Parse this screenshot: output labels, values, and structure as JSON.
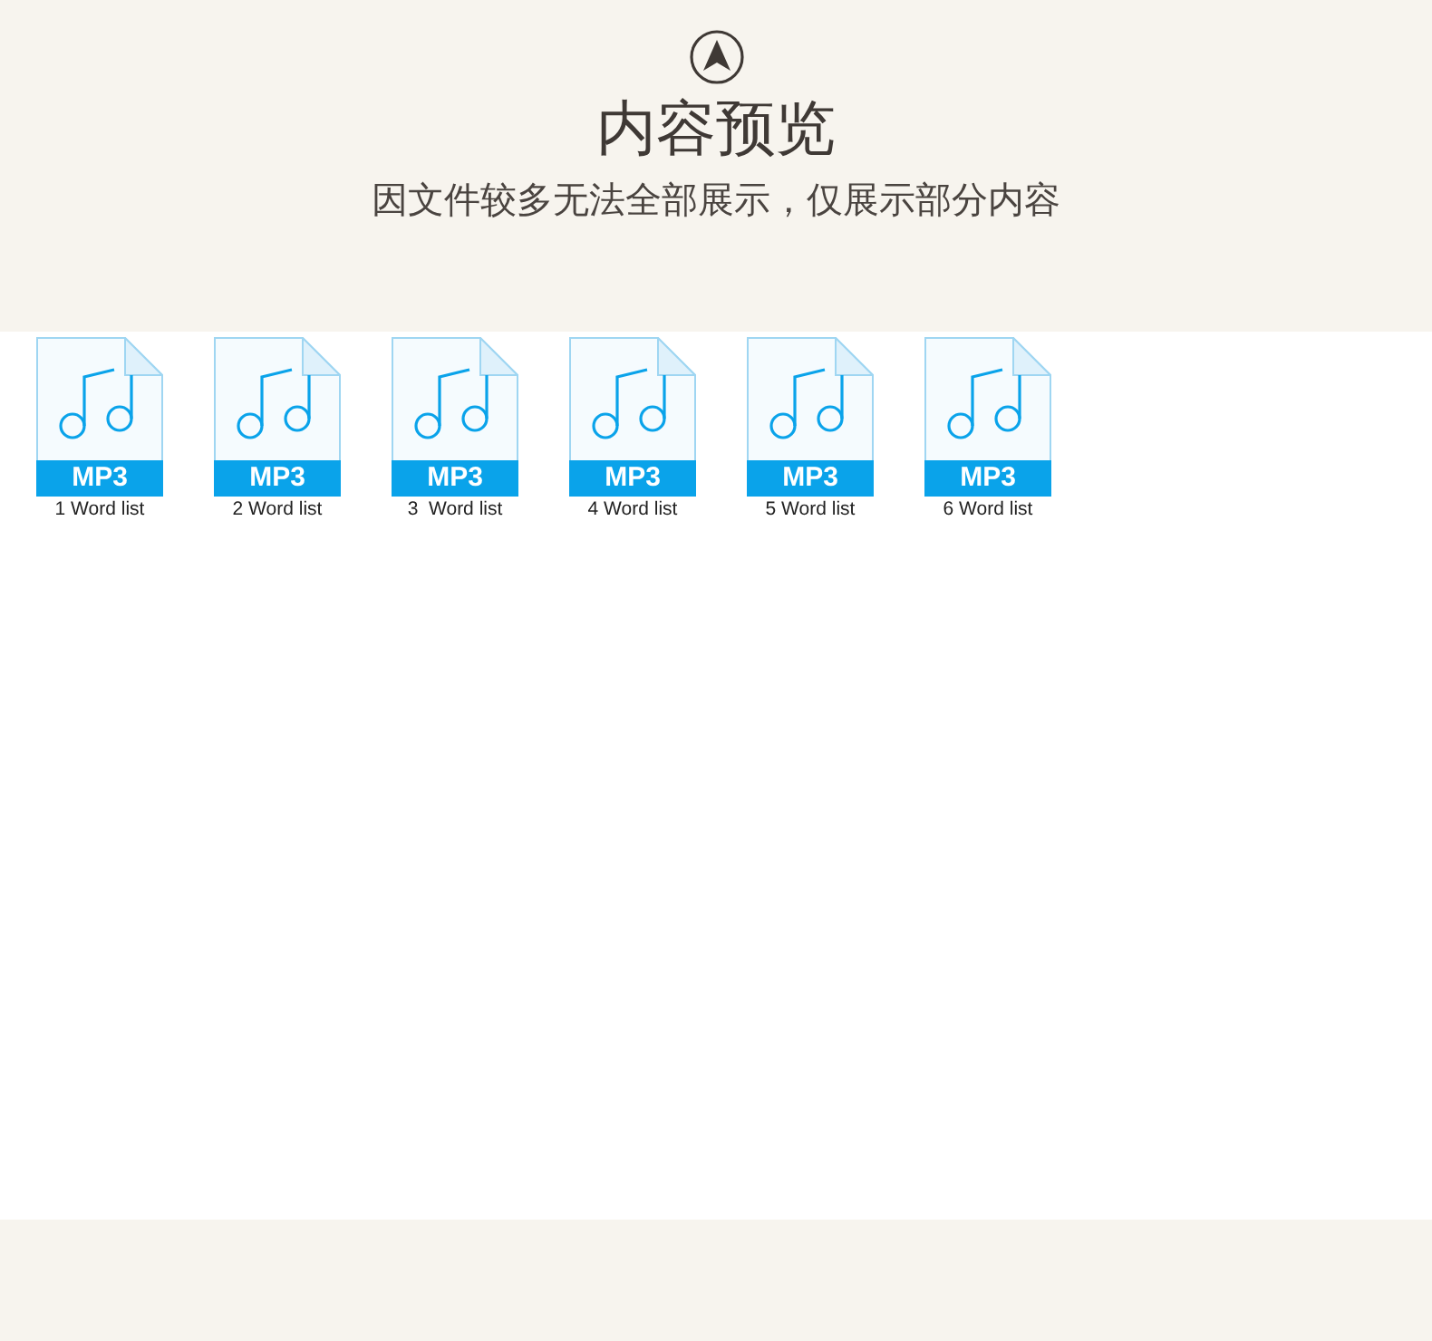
{
  "header": {
    "title": "内容预览",
    "subtitle": "因文件较多无法全部展示，仅展示部分内容"
  },
  "files": [
    {
      "type": "MP3",
      "name": "1 Word list"
    },
    {
      "type": "MP3",
      "name": "2 Word list"
    },
    {
      "type": "MP3",
      "name": "3  Word list"
    },
    {
      "type": "MP3",
      "name": "4 Word list"
    },
    {
      "type": "MP3",
      "name": "5 Word list"
    },
    {
      "type": "MP3",
      "name": "6 Word list"
    }
  ]
}
